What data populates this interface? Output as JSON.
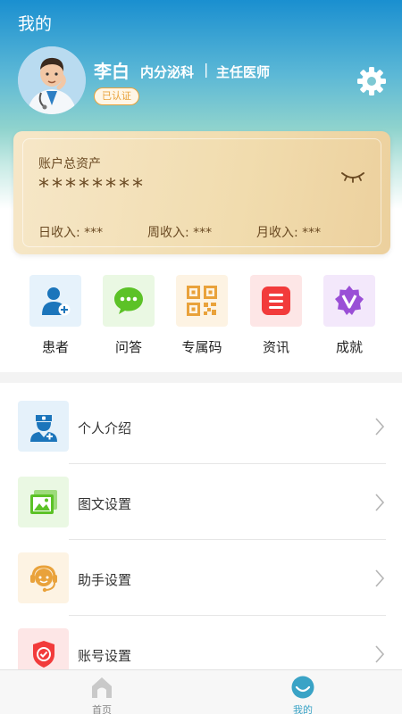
{
  "header": {
    "page_title": "我的",
    "name": "李白",
    "department": "内分泌科",
    "separator": "|",
    "role": "主任医师",
    "verified_badge": "已认证"
  },
  "asset_card": {
    "label": "账户总资产",
    "value": "********",
    "daily": "日收入: ***",
    "weekly": "周收入: ***",
    "monthly": "月收入: ***"
  },
  "quick_actions": [
    {
      "label": "患者",
      "icon": "patient-icon",
      "color": "#1b75bb"
    },
    {
      "label": "问答",
      "icon": "chat-icon",
      "color": "#5cc227"
    },
    {
      "label": "专属码",
      "icon": "qrcode-icon",
      "color": "#e9a23b"
    },
    {
      "label": "资讯",
      "icon": "news-icon",
      "color": "#f23b3b"
    },
    {
      "label": "成就",
      "icon": "achievement-icon",
      "color": "#9a4fd6"
    }
  ],
  "menu": [
    {
      "label": "个人介绍",
      "icon": "doctor-icon"
    },
    {
      "label": "图文设置",
      "icon": "image-icon"
    },
    {
      "label": "助手设置",
      "icon": "headset-icon"
    },
    {
      "label": "账号设置",
      "icon": "shield-icon"
    }
  ],
  "tabbar": {
    "home": "首页",
    "mine": "我的",
    "active_color": "#3aa3c6"
  }
}
